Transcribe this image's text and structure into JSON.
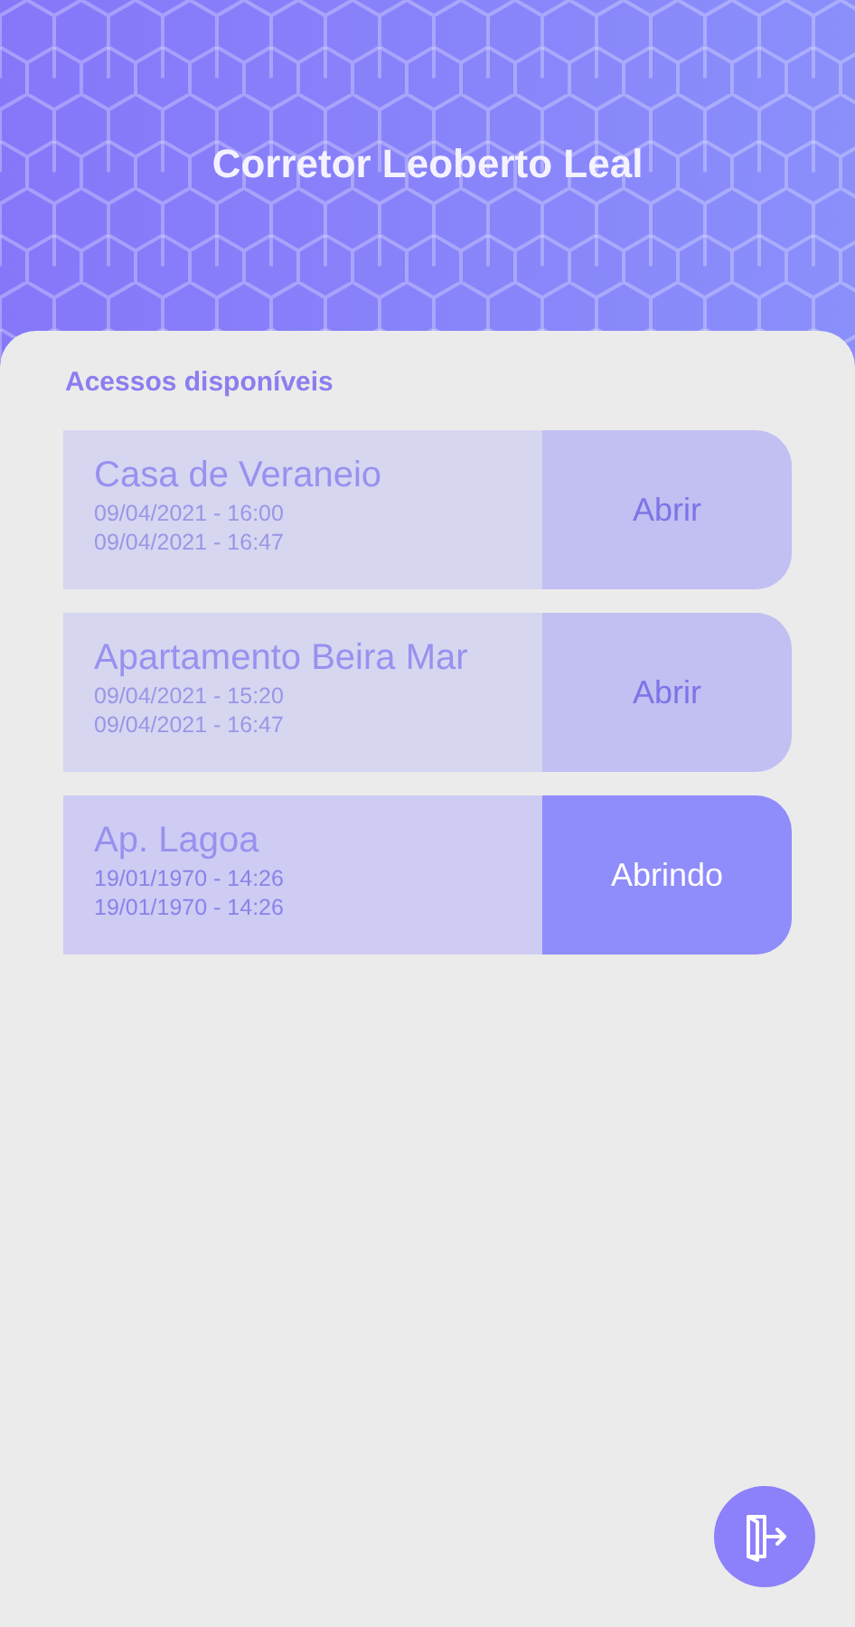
{
  "header": {
    "title": "Corretor Leoberto Leal"
  },
  "section_title": "Acessos disponíveis",
  "accesses": [
    {
      "name": "Casa de Veraneio",
      "start": "09/04/2021 - 16:00",
      "end": "09/04/2021 - 16:47",
      "action": "Abrir",
      "active": false
    },
    {
      "name": "Apartamento Beira Mar",
      "start": "09/04/2021 - 15:20",
      "end": "09/04/2021 - 16:47",
      "action": "Abrir",
      "active": false
    },
    {
      "name": "Ap. Lagoa",
      "start": "19/01/1970 - 14:26",
      "end": "19/01/1970 - 14:26",
      "action": "Abrindo",
      "active": true
    }
  ]
}
